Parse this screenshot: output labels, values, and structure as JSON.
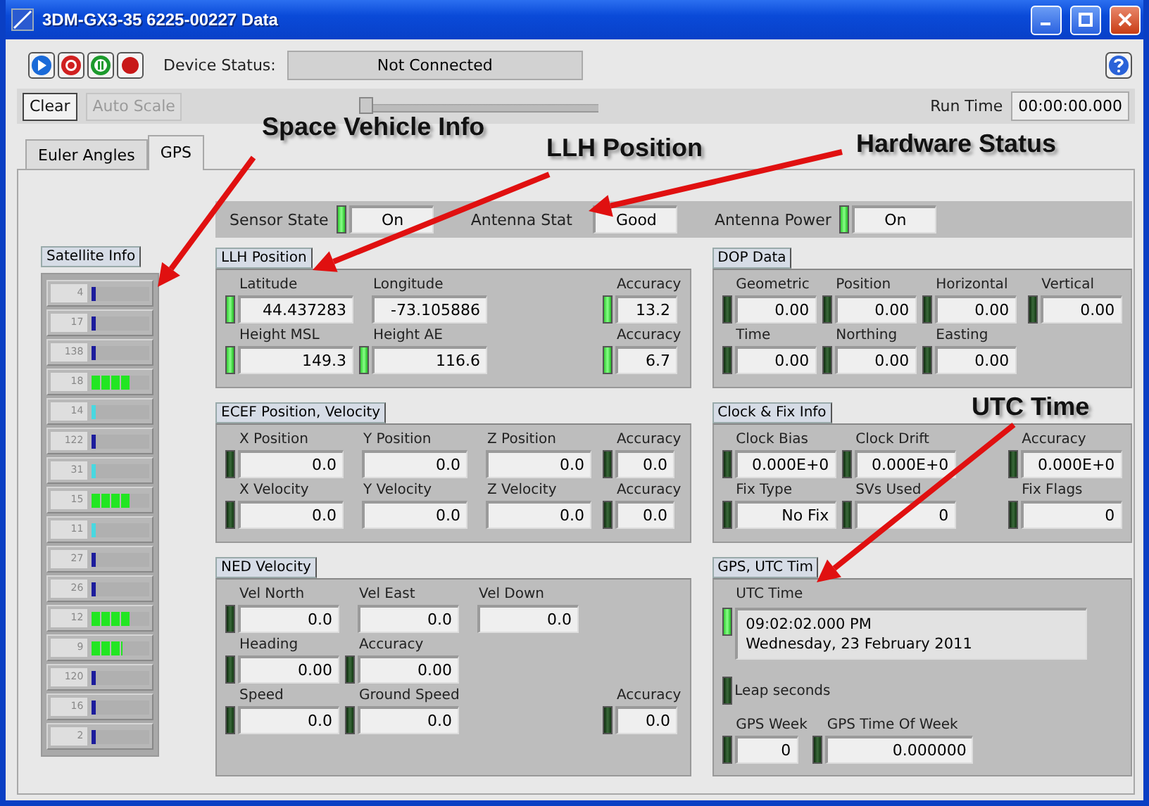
{
  "window": {
    "title": "3DM-GX3-35 6225-00227 Data"
  },
  "toolbar": {
    "device_status_label": "Device Status:",
    "device_status": "Not Connected"
  },
  "controls": {
    "buttons": [
      {
        "label": "Clear",
        "disabled": false
      },
      {
        "label": "Auto Scale",
        "disabled": true
      }
    ],
    "slider": {
      "level": 0
    },
    "run_time_label": "Run Time",
    "run_time": "00:00:00.000"
  },
  "tabs": [
    {
      "label": "Euler Angles",
      "selected": false
    },
    {
      "label": "GPS",
      "selected": true
    }
  ],
  "hardware_status": [
    {
      "label": "Sensor State",
      "kind": "indicator",
      "lit": true,
      "value": "On"
    },
    {
      "label": "Antenna Stat",
      "kind": "plain",
      "value": "Good"
    },
    {
      "label": "Antenna Power",
      "kind": "indicator",
      "lit": true,
      "value": "On"
    }
  ],
  "satellite_info": {
    "title": "Satellite Info",
    "satellites": [
      {
        "id": "4",
        "level": 0.06,
        "color": "#1c1c9c"
      },
      {
        "id": "17",
        "level": 0.06,
        "color": "#1c1c9c"
      },
      {
        "id": "138",
        "level": 0.06,
        "color": "#1c1c9c"
      },
      {
        "id": "18",
        "level": 0.62,
        "color": "#22e622"
      },
      {
        "id": "14",
        "level": 0.06,
        "color": "#48d8e0"
      },
      {
        "id": "122",
        "level": 0.06,
        "color": "#1c1c9c"
      },
      {
        "id": "31",
        "level": 0.06,
        "color": "#48d8e0"
      },
      {
        "id": "15",
        "level": 0.62,
        "color": "#22e622"
      },
      {
        "id": "11",
        "level": 0.06,
        "color": "#48d8e0"
      },
      {
        "id": "27",
        "level": 0.06,
        "color": "#1c1c9c"
      },
      {
        "id": "26",
        "level": 0.06,
        "color": "#1c1c9c"
      },
      {
        "id": "12",
        "level": 0.62,
        "color": "#22e622"
      },
      {
        "id": "9",
        "level": 0.5,
        "color": "#22e622"
      },
      {
        "id": "120",
        "level": 0.06,
        "color": "#1c1c9c"
      },
      {
        "id": "16",
        "level": 0.06,
        "color": "#1c1c9c"
      },
      {
        "id": "2",
        "level": 0.06,
        "color": "#1c1c9c"
      }
    ]
  },
  "groups": [
    {
      "kind": "fields",
      "title": "LLH Position",
      "rows": [
        [
          {
            "label": "Latitude",
            "value": "44.437283",
            "kind": "indicator",
            "lit": true
          },
          {
            "label": "Longitude",
            "value": "-73.105886",
            "kind": "plain"
          },
          {
            "label": "Accuracy",
            "value": "13.2",
            "kind": "indicator",
            "lit": true
          }
        ],
        [
          {
            "label": "Height MSL",
            "value": "149.3",
            "kind": "indicator",
            "lit": true
          },
          {
            "label": "Height AE",
            "value": "116.6",
            "kind": "indicator",
            "lit": true
          },
          {
            "label": "Accuracy",
            "value": "6.7",
            "kind": "indicator",
            "lit": true
          }
        ]
      ]
    },
    {
      "kind": "fields",
      "title": "ECEF Position, Velocity",
      "rows": [
        [
          {
            "label": "X Position",
            "value": "0.0",
            "kind": "indicator",
            "lit": false
          },
          {
            "label": "Y Position",
            "value": "0.0",
            "kind": "plain"
          },
          {
            "label": "Z Position",
            "value": "0.0",
            "kind": "plain"
          },
          {
            "label": "Accuracy",
            "value": "0.0",
            "kind": "indicator",
            "lit": false
          }
        ],
        [
          {
            "label": "X Velocity",
            "value": "0.0",
            "kind": "indicator",
            "lit": false
          },
          {
            "label": "Y Velocity",
            "value": "0.0",
            "kind": "plain"
          },
          {
            "label": "Z Velocity",
            "value": "0.0",
            "kind": "plain"
          },
          {
            "label": "Accuracy",
            "value": "0.0",
            "kind": "indicator",
            "lit": false
          }
        ]
      ]
    },
    {
      "kind": "fields",
      "title": "NED Velocity",
      "rows": [
        [
          {
            "label": "Vel North",
            "value": "0.0",
            "kind": "indicator",
            "lit": false
          },
          {
            "label": "Vel East",
            "value": "0.0",
            "kind": "plain"
          },
          {
            "label": "Vel Down",
            "value": "0.0",
            "kind": "plain"
          }
        ],
        [
          {
            "label": "Heading",
            "value": "0.00",
            "kind": "indicator",
            "lit": false
          },
          {
            "label": "Accuracy",
            "value": "0.00",
            "kind": "indicator",
            "lit": false
          }
        ],
        [
          {
            "label": "Speed",
            "value": "0.0",
            "kind": "indicator",
            "lit": false
          },
          {
            "label": "Ground Speed",
            "value": "0.0",
            "kind": "indicator",
            "lit": false
          },
          {
            "label": "Accuracy",
            "value": "0.0",
            "kind": "indicator",
            "lit": false
          }
        ]
      ]
    },
    {
      "kind": "fields",
      "title": "DOP Data",
      "rows": [
        [
          {
            "label": "Geometric",
            "value": "0.00",
            "kind": "indicator",
            "lit": false
          },
          {
            "label": "Position",
            "value": "0.00",
            "kind": "indicator",
            "lit": false
          },
          {
            "label": "Horizontal",
            "value": "0.00",
            "kind": "indicator",
            "lit": false
          },
          {
            "label": "Vertical",
            "value": "0.00",
            "kind": "indicator",
            "lit": false
          }
        ],
        [
          {
            "label": "Time",
            "value": "0.00",
            "kind": "indicator",
            "lit": false
          },
          {
            "label": "Northing",
            "value": "0.00",
            "kind": "indicator",
            "lit": false
          },
          {
            "label": "Easting",
            "value": "0.00",
            "kind": "indicator",
            "lit": false
          }
        ]
      ]
    },
    {
      "kind": "fields",
      "title": "Clock & Fix Info",
      "rows": [
        [
          {
            "label": "Clock Bias",
            "value": "0.000E+0",
            "kind": "indicator",
            "lit": false
          },
          {
            "label": "Clock Drift",
            "value": "0.000E+0",
            "kind": "indicator",
            "lit": false
          },
          {
            "label": "Accuracy",
            "value": "0.000E+0",
            "kind": "indicator",
            "lit": false
          }
        ],
        [
          {
            "label": "Fix Type",
            "value": "No Fix",
            "kind": "indicator",
            "lit": false
          },
          {
            "label": "SVs Used",
            "value": "0",
            "kind": "indicator",
            "lit": false
          },
          {
            "label": "Fix Flags",
            "value": "0",
            "kind": "indicator",
            "lit": false
          }
        ]
      ]
    },
    {
      "kind": "utc",
      "title": "GPS, UTC Tim",
      "utc": {
        "label": "UTC Time",
        "kind": "indicator",
        "lit": true,
        "lines": [
          "09:02:02.000 PM",
          "Wednesday, 23 February 2011"
        ]
      },
      "leap": {
        "label": "Leap seconds",
        "kind": "indicator",
        "lit": false
      },
      "fields": [
        {
          "label": "GPS Week",
          "value": "0",
          "kind": "indicator",
          "lit": false
        },
        {
          "label": "GPS Time Of Week",
          "value": "0.000000",
          "kind": "indicator",
          "lit": false
        }
      ]
    }
  ],
  "callouts": [
    {
      "text": "Space Vehicle Info"
    },
    {
      "text": "LLH Position"
    },
    {
      "text": "Hardware Status"
    },
    {
      "text": "UTC Time"
    }
  ]
}
